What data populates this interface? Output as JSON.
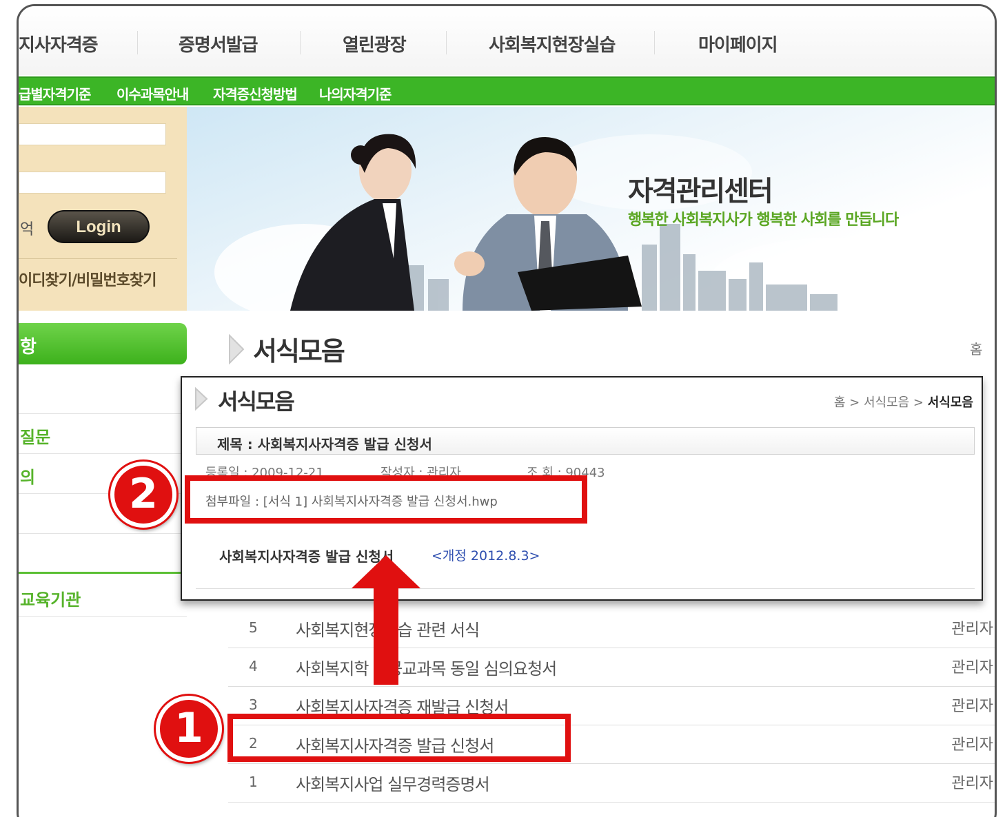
{
  "topnav": {
    "items": [
      "지사자격증",
      "증명서발급",
      "열린광장",
      "사회복지현장실습",
      "마이페이지"
    ]
  },
  "subnav": {
    "items": [
      "급별자격기준",
      "이수과목안내",
      "자격증신청방법",
      "나의자격기준"
    ]
  },
  "login": {
    "remember_label": "억",
    "button_label": "Login",
    "find_link": "이디찾기/비밀번호찾기"
  },
  "banner": {
    "title": "자격관리센터",
    "slogan": "행복한 사회복지사가 행복한 사회를 만듭니다"
  },
  "leftmenu": {
    "head": "항",
    "items": [
      "질문",
      "의",
      "교육기관"
    ]
  },
  "page": {
    "title": "서식모음",
    "home_icon": "홈"
  },
  "list": {
    "rows": [
      {
        "num": "5",
        "subject": "사회복지현장실습 관련 서식",
        "author": "관리자"
      },
      {
        "num": "4",
        "subject": "사회복지학 전공교과목 동일 심의요청서",
        "author": "관리자"
      },
      {
        "num": "3",
        "subject": "사회복지사자격증 재발급 신청서",
        "author": "관리자"
      },
      {
        "num": "2",
        "subject": "사회복지사자격증 발급 신청서",
        "author": "관리자"
      },
      {
        "num": "1",
        "subject": "사회복지사업 실무경력증명서",
        "author": "관리자"
      }
    ]
  },
  "detail": {
    "title": "서식모음",
    "breadcrumb_prefix": "홈 > 서식모음 > ",
    "breadcrumb_current": "서식모음",
    "subject": "제목 : 사회복지사자격증 발급 신청서",
    "regdate": "등록일 : 2009-12-21",
    "writer": "작성자 : 관리자",
    "views": "조    회 : 90443",
    "attachment": "첨부파일 : [서식 1] 사회복지사자격증 발급 신청서.hwp",
    "body": "사회복지사자격증 발급 신청서",
    "revision": "<개정 2012.8.3>"
  },
  "annotations": {
    "badge_1": "1",
    "badge_2": "2",
    "accent_color": "#e01010"
  }
}
